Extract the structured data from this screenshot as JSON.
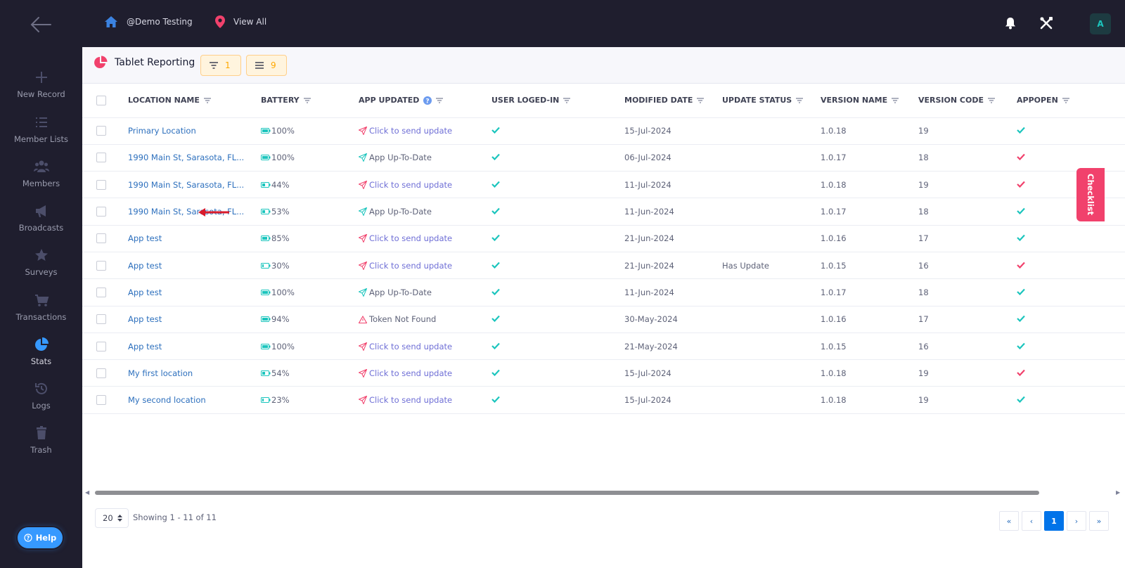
{
  "topbar": {
    "home_label": "@Demo Testing",
    "location_label": "View All"
  },
  "user": {
    "avatar_initial": "A"
  },
  "sidebar": {
    "items": [
      {
        "label": "New Record",
        "icon": "plus-icon"
      },
      {
        "label": "Member Lists",
        "icon": "list-icon"
      },
      {
        "label": "Members",
        "icon": "users-icon"
      },
      {
        "label": "Broadcasts",
        "icon": "megaphone-icon"
      },
      {
        "label": "Surveys",
        "icon": "star-icon"
      },
      {
        "label": "Transactions",
        "icon": "cart-icon"
      },
      {
        "label": "Stats",
        "icon": "pie-chart-icon",
        "active": true
      },
      {
        "label": "Logs",
        "icon": "history-icon"
      },
      {
        "label": "Trash",
        "icon": "trash-icon"
      }
    ],
    "help_label": "Help"
  },
  "page": {
    "title": "Tablet Reporting",
    "filter_count": "1",
    "columns_count": "9"
  },
  "checklist_label": "Checklist",
  "table": {
    "columns": [
      "LOCATION NAME",
      "BATTERY",
      "APP UPDATED",
      "USER LOGED-IN",
      "MODIFIED DATE",
      "UPDATE STATUS",
      "VERSION NAME",
      "VERSION CODE",
      "APPOPEN"
    ],
    "rows": [
      {
        "location": "Primary Location",
        "battery": "100%",
        "battery_level": 100,
        "app_updated": "Click to send update",
        "app_state": "send",
        "logged_in": true,
        "modified": "15-Jul-2024",
        "update_status": "",
        "version_name": "1.0.18",
        "version_code": "19",
        "appopen": true
      },
      {
        "location": "1990 Main St, Sarasota, FL...",
        "battery": "100%",
        "battery_level": 100,
        "app_updated": "App Up-To-Date",
        "app_state": "ok",
        "logged_in": true,
        "modified": "06-Jul-2024",
        "update_status": "",
        "version_name": "1.0.17",
        "version_code": "18",
        "appopen": false
      },
      {
        "location": "1990 Main St, Sarasota, FL...",
        "battery": "44%",
        "battery_level": 44,
        "app_updated": "Click to send update",
        "app_state": "send",
        "logged_in": true,
        "modified": "11-Jul-2024",
        "update_status": "",
        "version_name": "1.0.18",
        "version_code": "19",
        "appopen": false
      },
      {
        "location": "1990 Main St, Sarasota, FL...",
        "battery": "53%",
        "battery_level": 53,
        "app_updated": "App Up-To-Date",
        "app_state": "ok",
        "logged_in": true,
        "modified": "11-Jun-2024",
        "update_status": "",
        "version_name": "1.0.17",
        "version_code": "18",
        "appopen": true
      },
      {
        "location": "App test",
        "battery": "85%",
        "battery_level": 85,
        "app_updated": "Click to send update",
        "app_state": "send",
        "logged_in": true,
        "modified": "21-Jun-2024",
        "update_status": "",
        "version_name": "1.0.16",
        "version_code": "17",
        "appopen": true
      },
      {
        "location": "App test",
        "battery": "30%",
        "battery_level": 30,
        "app_updated": "Click to send update",
        "app_state": "send",
        "logged_in": true,
        "modified": "21-Jun-2024",
        "update_status": "Has Update",
        "version_name": "1.0.15",
        "version_code": "16",
        "appopen": false
      },
      {
        "location": "App test",
        "battery": "100%",
        "battery_level": 100,
        "app_updated": "App Up-To-Date",
        "app_state": "ok",
        "logged_in": true,
        "modified": "11-Jun-2024",
        "update_status": "",
        "version_name": "1.0.17",
        "version_code": "18",
        "appopen": true
      },
      {
        "location": "App test",
        "battery": "94%",
        "battery_level": 94,
        "app_updated": "Token Not Found",
        "app_state": "warn",
        "logged_in": true,
        "modified": "30-May-2024",
        "update_status": "",
        "version_name": "1.0.16",
        "version_code": "17",
        "appopen": true
      },
      {
        "location": "App test",
        "battery": "100%",
        "battery_level": 100,
        "app_updated": "Click to send update",
        "app_state": "send",
        "logged_in": true,
        "modified": "21-May-2024",
        "update_status": "",
        "version_name": "1.0.15",
        "version_code": "16",
        "appopen": true
      },
      {
        "location": "My first location",
        "battery": "54%",
        "battery_level": 54,
        "app_updated": "Click to send update",
        "app_state": "send",
        "logged_in": true,
        "modified": "15-Jul-2024",
        "update_status": "",
        "version_name": "1.0.18",
        "version_code": "19",
        "appopen": false
      },
      {
        "location": "My second location",
        "battery": "23%",
        "battery_level": 23,
        "app_updated": "Click to send update",
        "app_state": "send",
        "logged_in": true,
        "modified": "15-Jul-2024",
        "update_status": "",
        "version_name": "1.0.18",
        "version_code": "19",
        "appopen": true
      }
    ]
  },
  "pagination": {
    "per_page": "20",
    "showing": "Showing 1 - 11 of 11",
    "first": "«",
    "prev": "‹",
    "current": "1",
    "next": "›",
    "last": "»"
  },
  "colors": {
    "accent": "#0073e9",
    "check_green": "#1bc5bd",
    "check_red": "#f1416c",
    "link": "#2c6fbd",
    "warning": "#ffa800"
  }
}
